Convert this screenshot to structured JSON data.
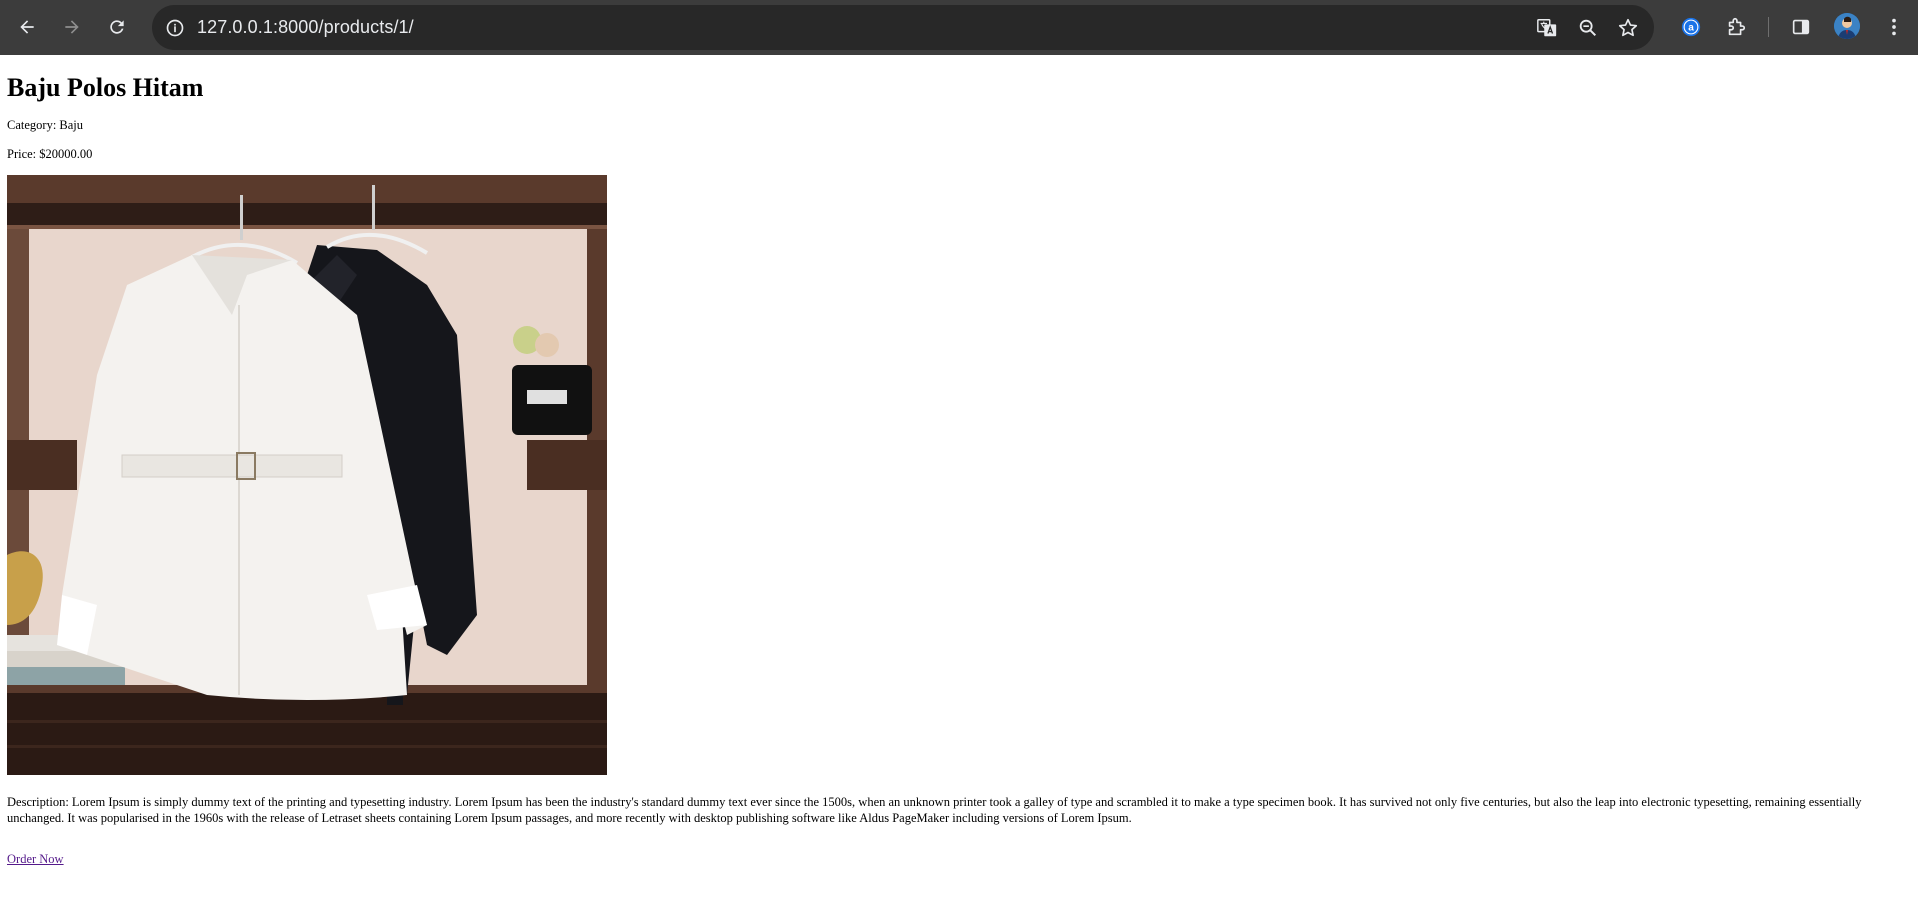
{
  "browser": {
    "url": "127.0.0.1:8000/products/1/",
    "icons": [
      "back-icon",
      "forward-icon",
      "reload-icon",
      "site-info-icon",
      "translate-icon",
      "zoom-icon",
      "bookmark-star-icon",
      "extension-a-icon",
      "extensions-puzzle-icon",
      "side-panel-icon",
      "profile-avatar",
      "menu-kebab-icon"
    ],
    "colors": {
      "chrome_bg": "#3c3c3c",
      "omnibox_bg": "#282828",
      "accent": "#8ab4f8"
    }
  },
  "product": {
    "name": "Baju Polos Hitam",
    "category_line": "Category: Baju",
    "price_line": "Price: $20000.00",
    "description_line": "Description: Lorem Ipsum is simply dummy text of the printing and typesetting industry. Lorem Ipsum has been the industry's standard dummy text ever since the 1500s, when an unknown printer took a galley of type and scrambled it to make a type specimen book. It has survived not only five centuries, but also the leap into electronic typesetting, remaining essentially unchanged. It was popularised in the 1960s with the release of Letraset sheets containing Lorem Ipsum passages, and more recently with desktop publishing software like Aldus PageMaker including versions of Lorem Ipsum.",
    "order_link": "Order Now"
  }
}
